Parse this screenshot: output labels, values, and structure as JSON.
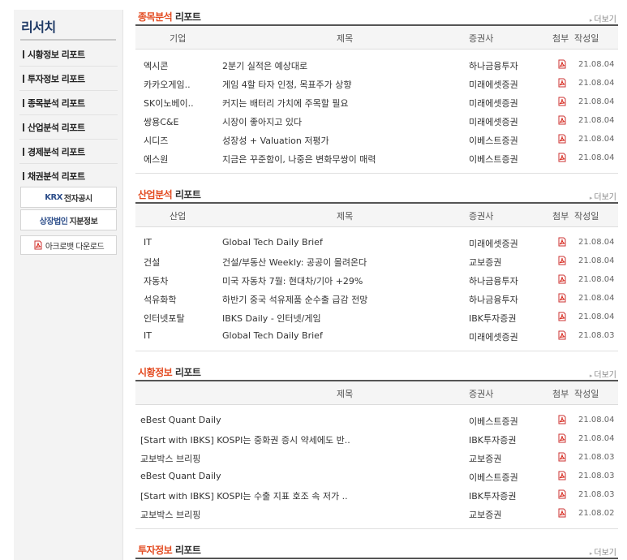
{
  "sidebar": {
    "title": "리서치",
    "menu": [
      "시황정보 리포트",
      "투자정보 리포트",
      "종목분석 리포트",
      "산업분석 리포트",
      "경제분석 리포트",
      "채권분석 리포트"
    ],
    "krx": {
      "accent": "KRX",
      "text": "전자공시"
    },
    "listed": {
      "accent": "상장법인",
      "text": "지분정보"
    },
    "acrobat": "아크로뱃 다운로드"
  },
  "more_label": "더보기",
  "stock": {
    "title_accent": "종목분석",
    "title_rest": " 리포트",
    "headers": {
      "col1": "기업",
      "title": "제목",
      "broker": "증권사",
      "attach": "첨부",
      "date": "작성일"
    },
    "rows": [
      {
        "col1": "엑시콘",
        "title": "2분기 실적은 예상대로",
        "broker": "하나금융투자",
        "date": "21.08.04"
      },
      {
        "col1": "카카오게임..",
        "title": "게임 4할 타자 인정, 목표주가 상향",
        "broker": "미래에셋증권",
        "date": "21.08.04"
      },
      {
        "col1": "SK이노베이..",
        "title": "커지는 배터리 가치에 주목할 필요",
        "broker": "미래에셋증권",
        "date": "21.08.04"
      },
      {
        "col1": "쌍용C&E",
        "title": "시장이 좋아지고 있다",
        "broker": "미래에셋증권",
        "date": "21.08.04"
      },
      {
        "col1": "시디즈",
        "title": "성장성 + Valuation 저평가",
        "broker": "이베스트증권",
        "date": "21.08.04"
      },
      {
        "col1": "에스원",
        "title": "지금은 꾸준함이, 나중은 변화무쌍이 매력",
        "broker": "이베스트증권",
        "date": "21.08.04"
      }
    ]
  },
  "industry": {
    "title_accent": "산업분석",
    "title_rest": " 리포트",
    "headers": {
      "col1": "산업",
      "title": "제목",
      "broker": "증권사",
      "attach": "첨부",
      "date": "작성일"
    },
    "rows": [
      {
        "col1": "IT",
        "title": "Global Tech Daily Brief",
        "broker": "미래에셋증권",
        "date": "21.08.04"
      },
      {
        "col1": "건설",
        "title": "건설/부동산 Weekly: 공공이 몰려온다",
        "broker": "교보증권",
        "date": "21.08.04"
      },
      {
        "col1": "자동차",
        "title": "미국 자동차 7월: 현대차/기아 +29%",
        "broker": "하나금융투자",
        "date": "21.08.04"
      },
      {
        "col1": "석유화학",
        "title": "하반기 중국 석유제품 순수출 급감 전망",
        "broker": "하나금융투자",
        "date": "21.08.04"
      },
      {
        "col1": "인터넷포탈",
        "title": "IBKS Daily - 인터넷/게임",
        "broker": "IBK투자증권",
        "date": "21.08.04"
      },
      {
        "col1": "IT",
        "title": "Global Tech Daily Brief",
        "broker": "미래에셋증권",
        "date": "21.08.03"
      }
    ]
  },
  "market": {
    "title_accent": "시황정보",
    "title_rest": " 리포트",
    "headers": {
      "title": "제목",
      "broker": "증권사",
      "attach": "첨부",
      "date": "작성일"
    },
    "rows": [
      {
        "title": "eBest Quant Daily",
        "broker": "이베스트증권",
        "date": "21.08.04"
      },
      {
        "title": "[Start with IBKS] KOSPI는 중화권 증시 약세에도 반..",
        "broker": "IBK투자증권",
        "date": "21.08.04"
      },
      {
        "title": "교보박스 브리핑",
        "broker": "교보증권",
        "date": "21.08.03"
      },
      {
        "title": "eBest Quant Daily",
        "broker": "이베스트증권",
        "date": "21.08.03"
      },
      {
        "title": "[Start with IBKS] KOSPI는 수출 지표 호조 속 저가 ..",
        "broker": "IBK투자증권",
        "date": "21.08.03"
      },
      {
        "title": "교보박스 브리핑",
        "broker": "교보증권",
        "date": "21.08.02"
      }
    ]
  },
  "invest": {
    "title_accent": "투자정보",
    "title_rest": " 리포트"
  },
  "colors": {
    "accent": "#e34b21",
    "navy": "#1f3a66",
    "pdf_red": "#d8281c"
  }
}
